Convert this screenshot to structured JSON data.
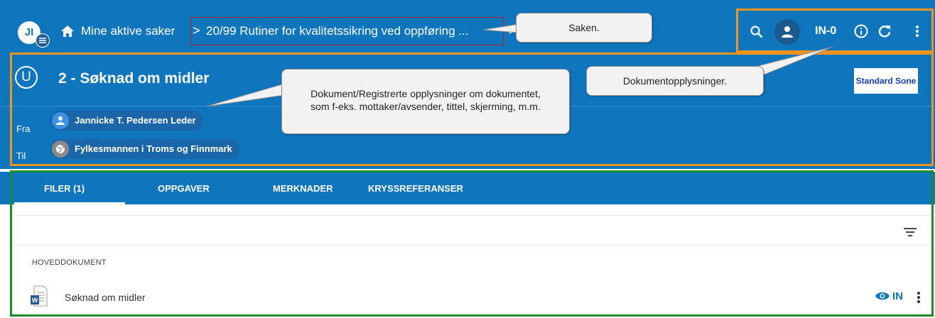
{
  "app": {
    "logo_text": "JI"
  },
  "breadcrumb": {
    "home": "Mine aktive saker",
    "separator": ">",
    "case": "20/99 Rutiner for kvalitetssikring ved oppføring ..."
  },
  "header": {
    "user_code": "IN-0"
  },
  "document": {
    "status_letter": "U",
    "title": "2 - Søknad om midler",
    "classification": "Standard Sone",
    "from_label": "Fra",
    "from_value": "Jannicke T. Pedersen Leder",
    "to_label": "Til",
    "to_value": "Fylkesmannen i Troms og Finnmark"
  },
  "callouts": {
    "saken": "Saken.",
    "dokumentopplysninger": "Dokumentopplysninger.",
    "description_line1": "Dokument/Registrerte opplysninger om dokumentet,",
    "description_line2": "som f-eks. mottaker/avsender, tittel, skjerming, m.m."
  },
  "tabs": [
    "FILER (1)",
    "OPPGAVER",
    "MERKNADER",
    "KRYSSREFERANSER"
  ],
  "files": {
    "section_title": "HOVEDDOKUMENT",
    "file_name": "Søknad om midler",
    "file_status": "IN"
  },
  "colors": {
    "primary": "#0f76bd",
    "highlight_orange": "#f0941d",
    "highlight_green": "#1b8b2b",
    "highlight_red": "#b21f2b"
  }
}
